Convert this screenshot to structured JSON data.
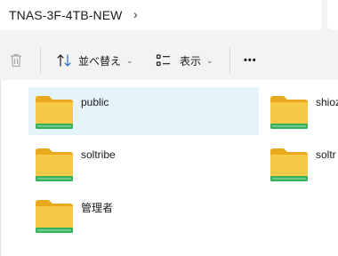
{
  "address_bar": {
    "path": "TNAS-3F-4TB-NEW",
    "separator": "›"
  },
  "toolbar": {
    "sort_label": "並べ替え",
    "view_label": "表示",
    "more": "•••",
    "dropdown": "⌄"
  },
  "folders": [
    {
      "name": "public",
      "selected": true
    },
    {
      "name": "shioz",
      "selected": false
    },
    {
      "name": "soltribe",
      "selected": false
    },
    {
      "name": "soltr",
      "selected": false
    },
    {
      "name": "管理者",
      "selected": false
    }
  ],
  "colors": {
    "folder_yellow": "#f7c948",
    "folder_green": "#34b15a",
    "selection": "#e5f3fb"
  }
}
